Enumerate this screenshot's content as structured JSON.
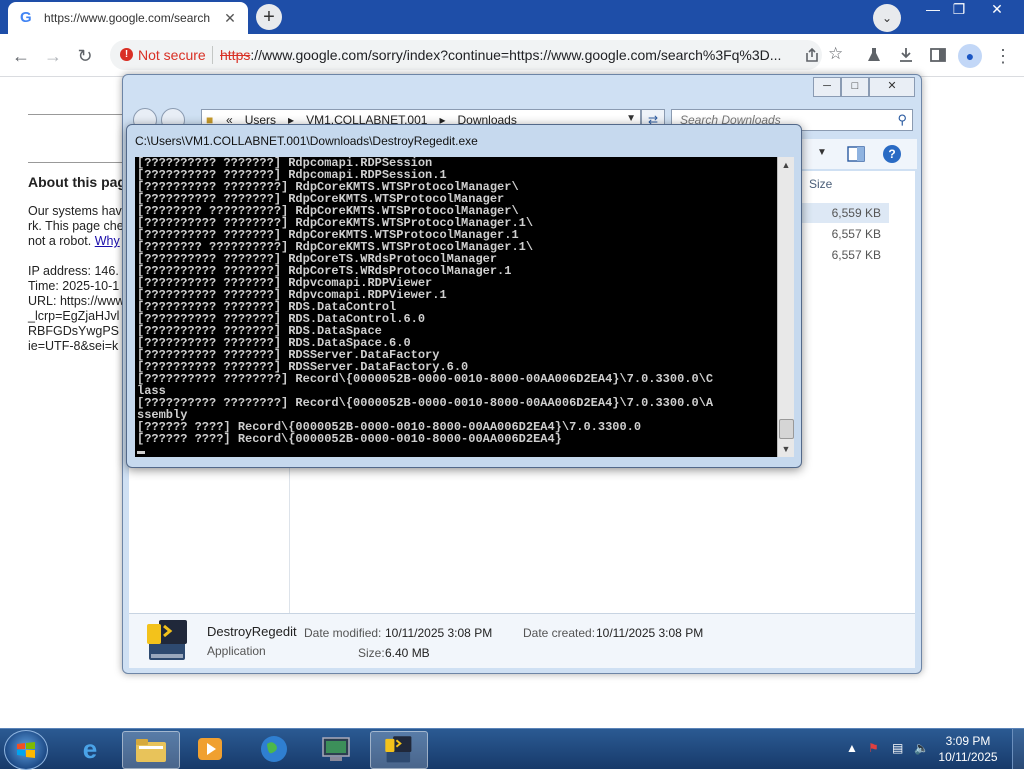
{
  "browser": {
    "tab_title": "https://www.google.com/search",
    "tab_close": "✕",
    "new_tab": "+",
    "tab_search": "⌄",
    "window_controls": {
      "minimize": "—",
      "restore": "❐",
      "close": "✕"
    },
    "security_label": "Not secure",
    "url_protocol": "https",
    "url_rest": "://www.google.com/sorry/index?continue=https://www.google.com/search%3Fq%3D..."
  },
  "google_page": {
    "heading": "About this page",
    "para_line1": "Our systems have",
    "para_line2": "rk. This page che",
    "para_line3_pre": "not a robot. ",
    "para_link": "Why",
    "ip_line": "IP address: 146.",
    "time_line": "Time: 2025-10-1",
    "url_line": "URL: https://www",
    "url_line2": "_lcrp=EgZjaHJvl",
    "url_line3": "RBFGDsYwgPS",
    "url_line4": "ie=UTF-8&sei=k"
  },
  "explorer": {
    "breadcrumbs": [
      "«",
      "Users",
      "▸",
      "VM1.COLLABNET.001",
      "▸",
      "Downloads"
    ],
    "search_placeholder": "Search Downloads",
    "column_size": "Size",
    "sizes": [
      "6,559 KB",
      "6,557 KB",
      "6,557 KB"
    ],
    "details": {
      "name": "DestroyRegedit",
      "type": "Application",
      "date_modified_label": "Date modified:",
      "date_modified": "10/11/2025 3:08 PM",
      "date_created_label": "Date created:",
      "date_created": "10/11/2025 3:08 PM",
      "size_label": "Size:",
      "size": "6.40 MB"
    }
  },
  "console": {
    "title": "C:\\Users\\VM1.COLLABNET.001\\Downloads\\DestroyRegedit.exe",
    "lines": [
      "[?????????? ???????] Rdpcomapi.RDPSession",
      "[?????????? ???????] Rdpcomapi.RDPSession.1",
      "[?????????? ????????] RdpCoreKMTS.WTSProtocolManager\\",
      "[?????????? ???????] RdpCoreKMTS.WTSProtocolManager",
      "[???????? ??????????] RdpCoreKMTS.WTSProtocolManager\\",
      "[?????????? ????????] RdpCoreKMTS.WTSProtocolManager.1\\",
      "[?????????? ???????] RdpCoreKMTS.WTSProtocolManager.1",
      "[???????? ??????????] RdpCoreKMTS.WTSProtocolManager.1\\",
      "[?????????? ???????] RdpCoreTS.WRdsProtocolManager",
      "[?????????? ???????] RdpCoreTS.WRdsProtocolManager.1",
      "[?????????? ???????] Rdpvcomapi.RDPViewer",
      "[?????????? ???????] Rdpvcomapi.RDPViewer.1",
      "[?????????? ???????] RDS.DataControl",
      "[?????????? ???????] RDS.DataControl.6.0",
      "[?????????? ???????] RDS.DataSpace",
      "[?????????? ???????] RDS.DataSpace.6.0",
      "[?????????? ???????] RDSServer.DataFactory",
      "[?????????? ???????] RDSServer.DataFactory.6.0",
      "[?????????? ????????] Record\\{0000052B-0000-0010-8000-00AA006D2EA4}\\7.0.3300.0\\C",
      "lass",
      "[?????????? ????????] Record\\{0000052B-0000-0010-8000-00AA006D2EA4}\\7.0.3300.0\\A",
      "ssembly",
      "[?????? ????] Record\\{0000052B-0000-0010-8000-00AA006D2EA4}\\7.0.3300.0",
      "[?????? ????] Record\\{0000052B-0000-0010-8000-00AA006D2EA4}"
    ]
  },
  "taskbar": {
    "clock_time": "3:09 PM",
    "clock_date": "10/11/2025"
  },
  "colors": {
    "chrome_frame": "#1e4ea8",
    "not_secure": "#d93025",
    "console_bg": "#000000",
    "taskbar": "#1f4677"
  }
}
